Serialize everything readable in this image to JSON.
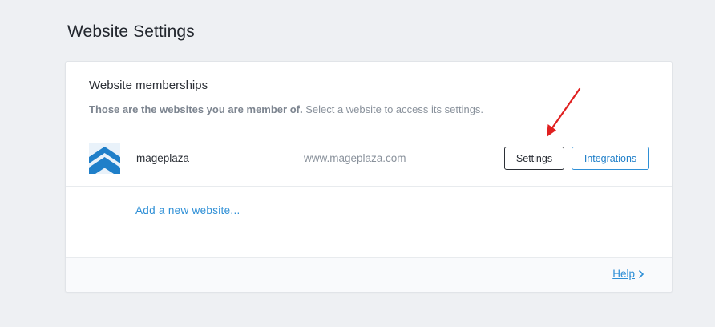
{
  "page": {
    "title": "Website Settings"
  },
  "memberships": {
    "title": "Website memberships",
    "description_bold": "Those are the websites you are member of.",
    "description_rest": " Select a website to access its settings.",
    "sites": [
      {
        "name": "mageplaza",
        "url": "www.mageplaza.com",
        "logo_icon": "mageplaza-logo-icon",
        "settings_label": "Settings",
        "integrations_label": "Integrations"
      }
    ],
    "add_label": "Add a new website..."
  },
  "footer": {
    "help_label": "Help"
  },
  "colors": {
    "link": "#2e8fd6",
    "logo_blue": "#1f7fc9",
    "annotation_arrow": "#e02020",
    "background": "#eef0f3"
  }
}
